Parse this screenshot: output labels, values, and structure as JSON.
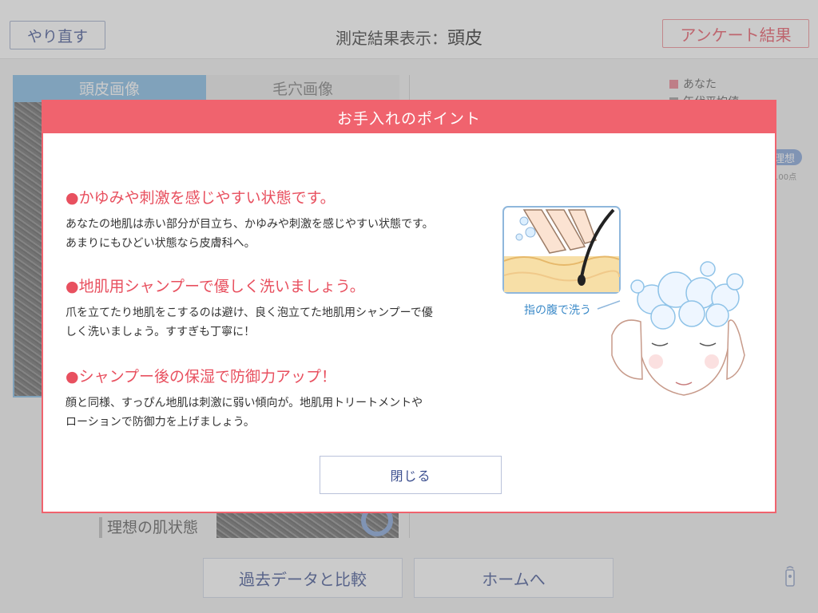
{
  "header": {
    "redo_label": "やり直す",
    "title_prefix": "測定結果表示：",
    "title_main": "頭皮",
    "survey_label": "アンケート結果"
  },
  "tabs": [
    {
      "label": "頭皮画像",
      "active": true
    },
    {
      "label": "毛穴画像",
      "active": false
    }
  ],
  "legend": [
    {
      "label": "あなた",
      "color": "#e87a8a"
    },
    {
      "label": "年代平均値",
      "color": "#9a9a9a"
    }
  ],
  "ideal_pill": "理想",
  "score_max": "100点",
  "ideal_section_label": "理想の肌状態",
  "bottom": {
    "compare_label": "過去データと比較",
    "home_label": "ホームへ"
  },
  "modal": {
    "title": "お手入れのポイント",
    "tips": [
      {
        "heading": "●かゆみや刺激を感じやすい状態です。",
        "line1": "あなたの地肌は赤い部分が目立ち、かゆみや刺激を感じやすい状態です。",
        "line2": "あまりにもひどい状態なら皮膚科へ。"
      },
      {
        "heading": "●地肌用シャンプーで優しく洗いましょう。",
        "line1": "爪を立てたり地肌をこするのは避け、良く泡立てた地肌用シャンプーで優",
        "line2": "しく洗いましょう。すすぎも丁寧に！"
      },
      {
        "heading": "●シャンプー後の保湿で防御力アップ！",
        "line1": "顔と同様、すっぴん地肌は刺激に弱い傾向が。地肌用トリートメントや",
        "line2": "ローションで防御力を上げましょう。"
      }
    ],
    "illustration_caption": "指の腹で洗う",
    "close_label": "閉じる"
  },
  "colors": {
    "accent_red": "#f0636e",
    "accent_blue": "#7fb9e3",
    "button_text": "#3c4f8f"
  }
}
